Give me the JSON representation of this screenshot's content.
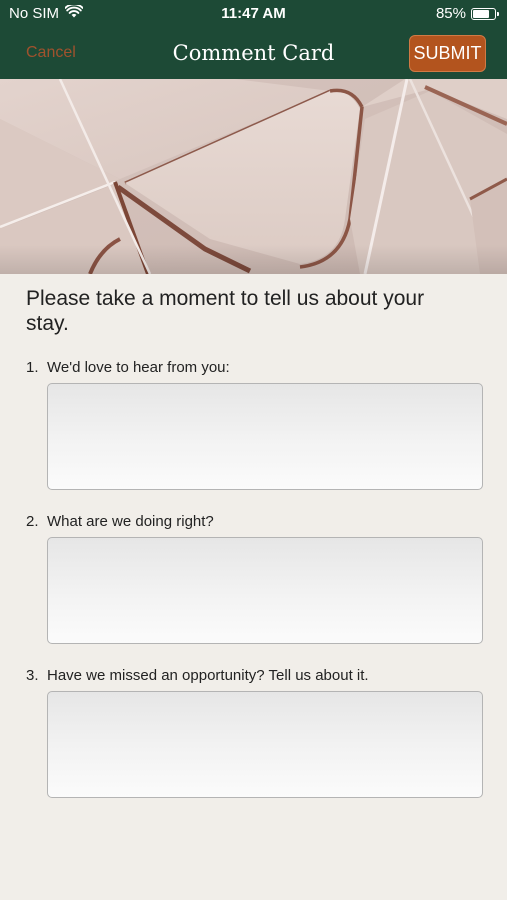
{
  "status_bar": {
    "carrier": "No SIM",
    "time": "11:47 AM",
    "battery_percent": "85%",
    "battery_level": 0.85,
    "wifi_icon": "wifi-icon",
    "battery_icon": "battery-icon"
  },
  "nav": {
    "cancel_label": "Cancel",
    "title": "Comment Card",
    "submit_label": "SUBMIT"
  },
  "colors": {
    "header_bg": "#1d4a36",
    "accent": "#b3541e",
    "cancel_text": "#a0522d",
    "page_bg": "#f1eee9"
  },
  "hero": {
    "image": "envelopes-photo"
  },
  "form": {
    "intro": "Please take a moment to tell us about your stay.",
    "questions": [
      {
        "number": "1.",
        "label": "We'd love to hear from you:",
        "value": ""
      },
      {
        "number": "2.",
        "label": "What are we doing right?",
        "value": ""
      },
      {
        "number": "3.",
        "label": "Have we missed an opportunity? Tell us about it.",
        "value": ""
      }
    ]
  }
}
